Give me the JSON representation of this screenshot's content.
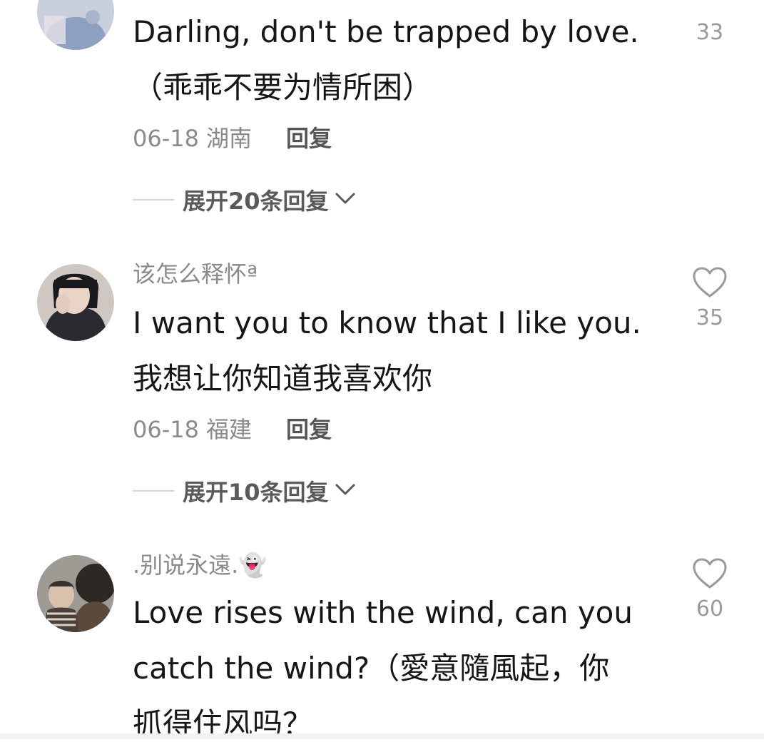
{
  "comments": [
    {
      "username": "",
      "text_lines": [
        "Darling, don't be trapped by love.",
        "（乖乖不要为情所困）"
      ],
      "date": "06-18",
      "location": "湖南",
      "reply_label": "回复",
      "expand_label": "展开20条回复",
      "likes": "33",
      "avatar_colors": [
        "#c9cfdc",
        "#8ea0bf",
        "#e8e1ea"
      ]
    },
    {
      "username": "该怎么释怀ª",
      "text_lines": [
        "I want you to know that I like you.",
        "我想让你知道我喜欢你"
      ],
      "date": "06-18",
      "location": "福建",
      "reply_label": "回复",
      "expand_label": "展开10条回复",
      "likes": "35",
      "avatar_colors": [
        "#2a2a30",
        "#e9d4c6",
        "#1a1a1e"
      ]
    },
    {
      "username": ".别说永遠.👻",
      "text_lines": [
        "Love rises with the wind, can you",
        "catch the wind?（愛意隨風起，你",
        "抓得住风吗？"
      ],
      "likes": "60",
      "avatar_colors": [
        "#9e9a94",
        "#5b4a3c",
        "#d8c2ad"
      ]
    }
  ],
  "icons": {
    "like": "heart-outline-icon",
    "expand": "chevron-down-icon"
  }
}
